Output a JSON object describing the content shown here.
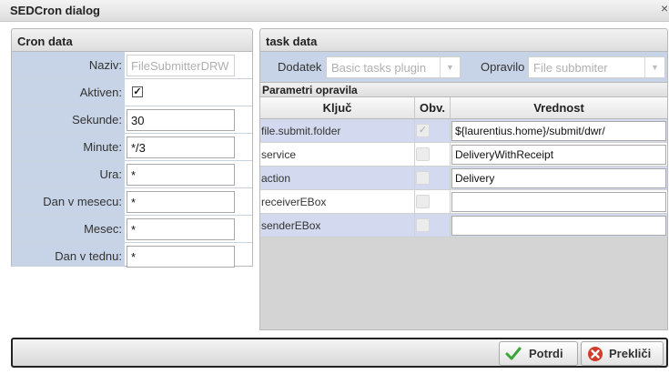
{
  "window": {
    "title": "SEDCron dialog",
    "close_glyph": "×"
  },
  "cron": {
    "header": "Cron data",
    "fields": [
      {
        "label": "Naziv:",
        "value": "FileSubmitterDRW"
      },
      {
        "label": "Aktiven:",
        "checked": true
      },
      {
        "label": "Sekunde:",
        "value": "30"
      },
      {
        "label": "Minute:",
        "value": "*/3"
      },
      {
        "label": "Ura:",
        "value": "*"
      },
      {
        "label": "Dan v mesecu:",
        "value": "*"
      },
      {
        "label": "Mesec:",
        "value": "*"
      },
      {
        "label": "Dan v tednu:",
        "value": "*"
      }
    ]
  },
  "task": {
    "header": "task data",
    "dodatek_label": "Dodatek",
    "dodatek_value": "Basic tasks plugin",
    "opravilo_label": "Opravilo",
    "opravilo_value": "File subbmiter",
    "params_header": "Parametri opravila",
    "columns": [
      "Ključ",
      "Obv.",
      "Vrednost"
    ],
    "rows": [
      {
        "key": "file.submit.folder",
        "required": true,
        "value": "${laurentius.home}/submit/dwr/"
      },
      {
        "key": "service",
        "required": false,
        "value": "DeliveryWithReceipt"
      },
      {
        "key": "action",
        "required": false,
        "value": "Delivery"
      },
      {
        "key": "receiverEBox",
        "required": false,
        "value": ""
      },
      {
        "key": "senderEBox",
        "required": false,
        "value": ""
      }
    ]
  },
  "buttons": {
    "ok": "Potrdi",
    "cancel": "Prekliči"
  },
  "colors": {
    "label_bg": "#c7d3e6",
    "alt_row": "#d3d9ee",
    "ok_icon": "#3aa63a",
    "cancel_icon": "#d23a2a"
  },
  "icons": {
    "checkbox": "check-icon",
    "ok": "check-icon",
    "cancel": "x-icon",
    "dropdown": "chevron-down-icon"
  }
}
